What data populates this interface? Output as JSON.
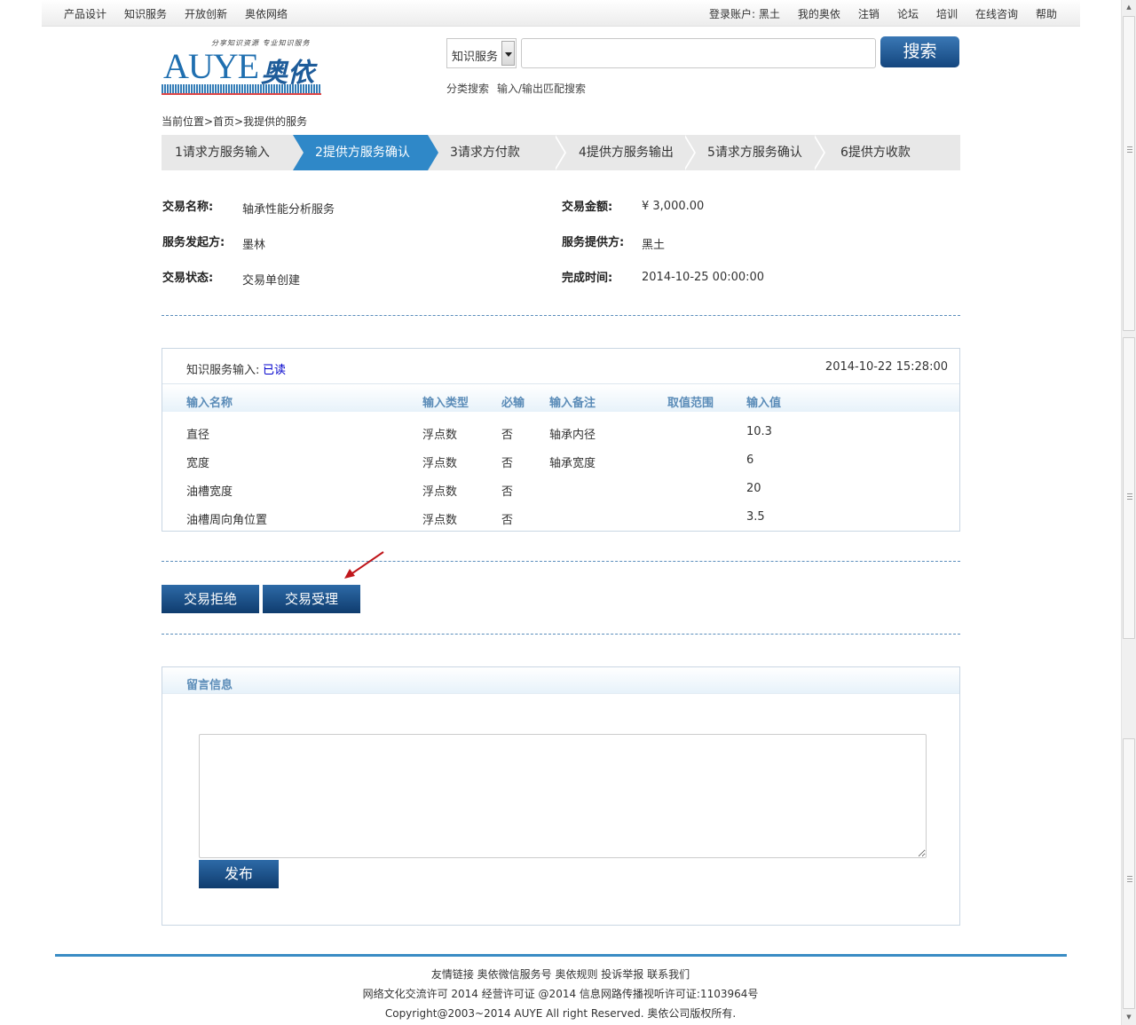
{
  "topbar": {
    "left_links": [
      "产品设计",
      "知识服务",
      "开放创新",
      "奥依网络"
    ],
    "account_prefix": "登录账户:",
    "account_name": "黑土",
    "right_links": [
      "我的奥依",
      "注销",
      "论坛",
      "培训",
      "在线咨询",
      "帮助"
    ]
  },
  "logo": {
    "slogan": "分享知识资源 专业知识服务",
    "brand_en": "AUYE",
    "brand_cn": "奥依"
  },
  "search": {
    "category": "知识服务",
    "placeholder": "",
    "button": "搜索",
    "links": [
      "分类搜索",
      "输入/输出匹配搜索"
    ]
  },
  "breadcrumb": "当前位置>首页>我提供的服务",
  "steps": [
    {
      "label": "1请求方服务输入",
      "active": false
    },
    {
      "label": "2提供方服务确认",
      "active": true
    },
    {
      "label": "3请求方付款",
      "active": false
    },
    {
      "label": "4提供方服务输出",
      "active": false
    },
    {
      "label": "5请求方服务确认",
      "active": false
    },
    {
      "label": "6提供方收款",
      "active": false
    }
  ],
  "transaction": {
    "name_label": "交易名称:",
    "name": "轴承性能分析服务",
    "amount_label": "交易金额:",
    "amount": "¥ 3,000.00",
    "initiator_label": "服务发起方:",
    "initiator": "墨林",
    "provider_label": "服务提供方:",
    "provider": "黑土",
    "status_label": "交易状态:",
    "status": "交易单创建",
    "finish_label": "完成时间:",
    "finish_time": "2014-10-25 00:00:00"
  },
  "input_panel": {
    "title": "知识服务输入:",
    "read_status": "已读",
    "timestamp": "2014-10-22 15:28:00",
    "columns": [
      "输入名称",
      "输入类型",
      "必输",
      "输入备注",
      "取值范围",
      "输入值"
    ],
    "rows": [
      [
        "直径",
        "浮点数",
        "否",
        "轴承内径",
        "",
        "10.3"
      ],
      [
        "宽度",
        "浮点数",
        "否",
        "轴承宽度",
        "",
        "6"
      ],
      [
        "油槽宽度",
        "浮点数",
        "否",
        "",
        "",
        "20"
      ],
      [
        "油槽周向角位置",
        "浮点数",
        "否",
        "",
        "",
        "3.5"
      ]
    ]
  },
  "actions": {
    "reject": "交易拒绝",
    "accept": "交易受理"
  },
  "message": {
    "title": "留言信息",
    "text": "",
    "publish": "发布"
  },
  "footer": {
    "links": "友情链接 奥依微信服务号 奥依规则 投诉举报 联系我们",
    "license": "网络文化交流许可 2014 经营许可证 @2014 信息网路传播视听许可证:1103964号",
    "copyright": "Copyright@2003~2014 AUYE All right Reserved. 奥依公司版权所有."
  },
  "colors": {
    "active_step": "#2f88c8",
    "button_dark": "#14467e",
    "table_header": "#5b8cb8",
    "link_read": "#0000cc"
  }
}
